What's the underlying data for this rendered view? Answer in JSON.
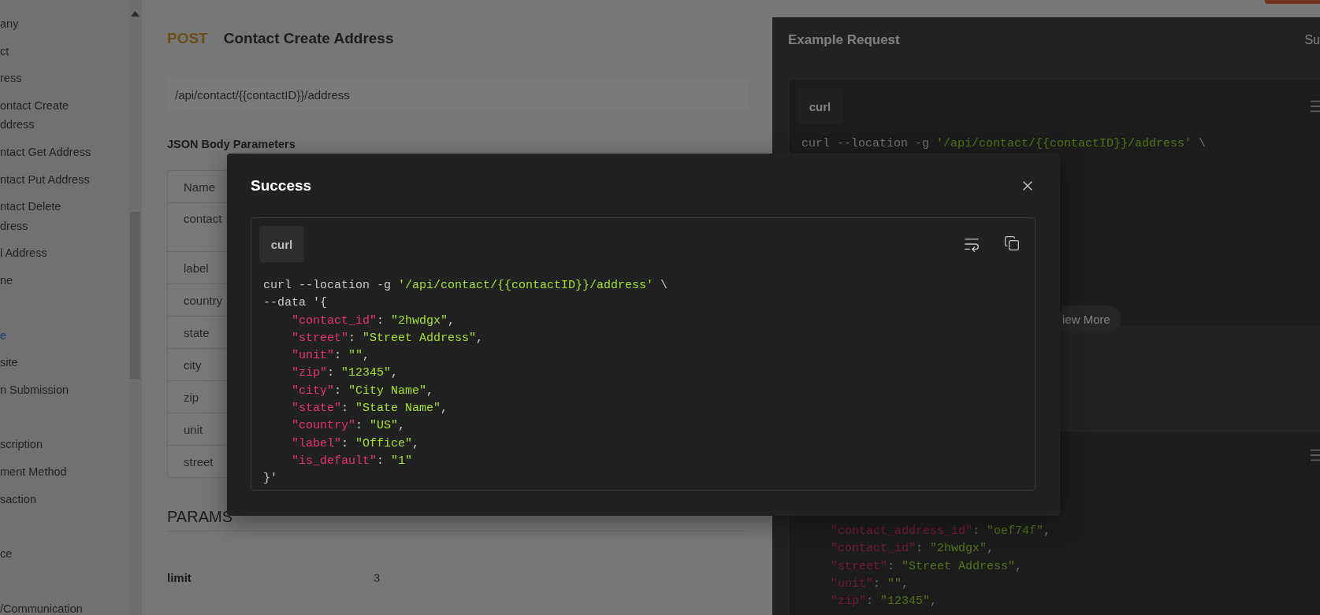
{
  "sidebar": {
    "groups": [
      {
        "items": [
          {
            "lines": [
              "any"
            ],
            "selected": false
          },
          {
            "lines": [
              "ct"
            ],
            "selected": false
          },
          {
            "lines": [
              "ress"
            ],
            "selected": false
          },
          {
            "lines": [
              "ontact Create",
              "ddress"
            ],
            "selected": false
          },
          {
            "lines": [
              "ntact Get Address"
            ],
            "selected": false
          },
          {
            "lines": [
              "ntact Put Address"
            ],
            "selected": false
          },
          {
            "lines": [
              "ntact Delete",
              "dress"
            ],
            "selected": false
          },
          {
            "lines": [
              "l Address"
            ],
            "selected": false
          },
          {
            "lines": [
              "ne"
            ],
            "selected": false
          }
        ]
      },
      {
        "items": [
          {
            "lines": [
              "e"
            ],
            "selected": true
          },
          {
            "lines": [
              "site"
            ],
            "selected": false
          },
          {
            "lines": [
              "n Submission"
            ],
            "selected": false
          }
        ]
      },
      {
        "items": [
          {
            "lines": [
              "scription"
            ],
            "selected": false
          },
          {
            "lines": [
              "ment Method"
            ],
            "selected": false
          },
          {
            "lines": [
              "saction"
            ],
            "selected": false
          }
        ]
      },
      {
        "items": [
          {
            "lines": [
              "ce"
            ],
            "selected": false
          }
        ]
      },
      {
        "items": [
          {
            "lines": [
              "/Communication"
            ],
            "selected": false
          }
        ]
      }
    ]
  },
  "endpoint": {
    "method": "POST",
    "title": "Contact Create Address",
    "url": "/api/contact/{{contactID}}/address"
  },
  "body_parameters": {
    "heading": "JSON Body Parameters",
    "column": "Name",
    "rows": [
      "contact",
      "label",
      "country",
      "state",
      "city",
      "zip",
      "unit",
      "street"
    ]
  },
  "params": {
    "heading": "PARAMS",
    "rows": [
      {
        "name": "limit",
        "value": "3"
      }
    ]
  },
  "example_request": {
    "title": "Example Request",
    "side_tab": "Su",
    "language": "curl",
    "request_lines": [
      {
        "indented": false,
        "tokens": [
          {
            "kind": "plain",
            "text": "curl --location -g "
          },
          {
            "kind": "string",
            "text": "'/api/contact/{{contactID}}/address'"
          },
          {
            "kind": "plain",
            "text": " \\"
          }
        ]
      }
    ],
    "view_more": "iew More",
    "response_lines": [
      {
        "indented": true,
        "tokens": [
          {
            "kind": "key",
            "text": "\"contact_address_id\""
          },
          {
            "kind": "plain",
            "text": ": "
          },
          {
            "kind": "string",
            "text": "\"oef74f\""
          },
          {
            "kind": "plain",
            "text": ","
          }
        ]
      },
      {
        "indented": true,
        "tokens": [
          {
            "kind": "key",
            "text": "\"contact_id\""
          },
          {
            "kind": "plain",
            "text": ": "
          },
          {
            "kind": "string",
            "text": "\"2hwdgx\""
          },
          {
            "kind": "plain",
            "text": ","
          }
        ]
      },
      {
        "indented": true,
        "tokens": [
          {
            "kind": "key",
            "text": "\"street\""
          },
          {
            "kind": "plain",
            "text": ": "
          },
          {
            "kind": "string",
            "text": "\"Street Address\""
          },
          {
            "kind": "plain",
            "text": ","
          }
        ]
      },
      {
        "indented": true,
        "tokens": [
          {
            "kind": "key",
            "text": "\"unit\""
          },
          {
            "kind": "plain",
            "text": ": "
          },
          {
            "kind": "string",
            "text": "\"\""
          },
          {
            "kind": "plain",
            "text": ","
          }
        ]
      },
      {
        "indented": true,
        "tokens": [
          {
            "kind": "key",
            "text": "\"zip\""
          },
          {
            "kind": "plain",
            "text": ": "
          },
          {
            "kind": "string",
            "text": "\"12345\""
          },
          {
            "kind": "plain",
            "text": ","
          }
        ]
      }
    ]
  },
  "modal": {
    "title": "Success",
    "language": "curl",
    "lines": [
      {
        "indented": false,
        "tokens": [
          {
            "kind": "plain",
            "text": "curl --location -g "
          },
          {
            "kind": "string",
            "text": "'/api/contact/{{contactID}}/address'"
          },
          {
            "kind": "plain",
            "text": " \\"
          }
        ]
      },
      {
        "indented": false,
        "tokens": [
          {
            "kind": "plain",
            "text": "--data '{"
          }
        ]
      },
      {
        "indented": true,
        "tokens": [
          {
            "kind": "key",
            "text": "\"contact_id\""
          },
          {
            "kind": "plain",
            "text": ": "
          },
          {
            "kind": "string",
            "text": "\"2hwdgx\""
          },
          {
            "kind": "plain",
            "text": ","
          }
        ]
      },
      {
        "indented": true,
        "tokens": [
          {
            "kind": "key",
            "text": "\"street\""
          },
          {
            "kind": "plain",
            "text": ": "
          },
          {
            "kind": "string",
            "text": "\"Street Address\""
          },
          {
            "kind": "plain",
            "text": ","
          }
        ]
      },
      {
        "indented": true,
        "tokens": [
          {
            "kind": "key",
            "text": "\"unit\""
          },
          {
            "kind": "plain",
            "text": ": "
          },
          {
            "kind": "string",
            "text": "\"\""
          },
          {
            "kind": "plain",
            "text": ","
          }
        ]
      },
      {
        "indented": true,
        "tokens": [
          {
            "kind": "key",
            "text": "\"zip\""
          },
          {
            "kind": "plain",
            "text": ": "
          },
          {
            "kind": "string",
            "text": "\"12345\""
          },
          {
            "kind": "plain",
            "text": ","
          }
        ]
      },
      {
        "indented": true,
        "tokens": [
          {
            "kind": "key",
            "text": "\"city\""
          },
          {
            "kind": "plain",
            "text": ": "
          },
          {
            "kind": "string",
            "text": "\"City Name\""
          },
          {
            "kind": "plain",
            "text": ","
          }
        ]
      },
      {
        "indented": true,
        "tokens": [
          {
            "kind": "key",
            "text": "\"state\""
          },
          {
            "kind": "plain",
            "text": ": "
          },
          {
            "kind": "string",
            "text": "\"State Name\""
          },
          {
            "kind": "plain",
            "text": ","
          }
        ]
      },
      {
        "indented": true,
        "tokens": [
          {
            "kind": "key",
            "text": "\"country\""
          },
          {
            "kind": "plain",
            "text": ": "
          },
          {
            "kind": "string",
            "text": "\"US\""
          },
          {
            "kind": "plain",
            "text": ","
          }
        ]
      },
      {
        "indented": true,
        "tokens": [
          {
            "kind": "key",
            "text": "\"label\""
          },
          {
            "kind": "plain",
            "text": ": "
          },
          {
            "kind": "string",
            "text": "\"Office\""
          },
          {
            "kind": "plain",
            "text": ","
          }
        ]
      },
      {
        "indented": true,
        "tokens": [
          {
            "kind": "key",
            "text": "\"is_default\""
          },
          {
            "kind": "plain",
            "text": ": "
          },
          {
            "kind": "string",
            "text": "\"1\""
          }
        ]
      },
      {
        "indented": false,
        "tokens": [
          {
            "kind": "plain",
            "text": "}'"
          }
        ]
      }
    ]
  }
}
